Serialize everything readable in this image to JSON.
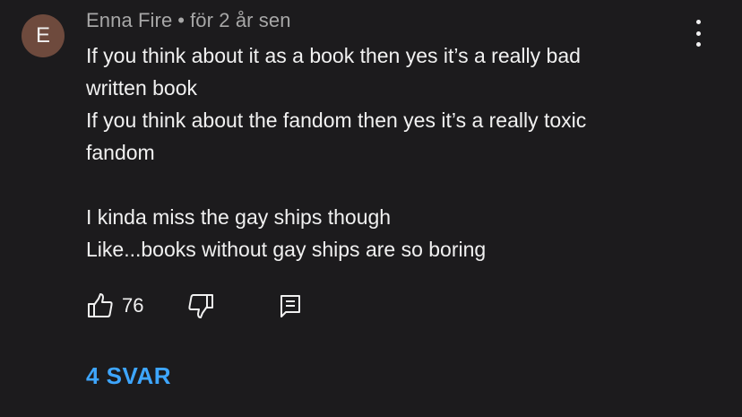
{
  "comment": {
    "avatar_letter": "E",
    "author": "Enna Fire",
    "separator": "•",
    "timestamp": "för 2 år sen",
    "lines": [
      "If you think about it as a book then yes it’s a really bad",
      "written book",
      "If you think about the fandom then yes it’s a really toxic",
      "fandom",
      "",
      "I kinda miss the gay ships though",
      "Like...books without gay ships are so boring"
    ],
    "like_count": "76",
    "replies_label": "4 SVAR"
  },
  "icons": {
    "menu": "more-vertical-icon",
    "like": "thumbs-up-icon",
    "dislike": "thumbs-down-icon",
    "reply": "comment-icon"
  },
  "colors": {
    "background": "#1c1b1d",
    "avatar": "#6e4a3d",
    "text": "#f1f1f1",
    "meta": "#a7a7a7",
    "link": "#3ea6ff"
  }
}
